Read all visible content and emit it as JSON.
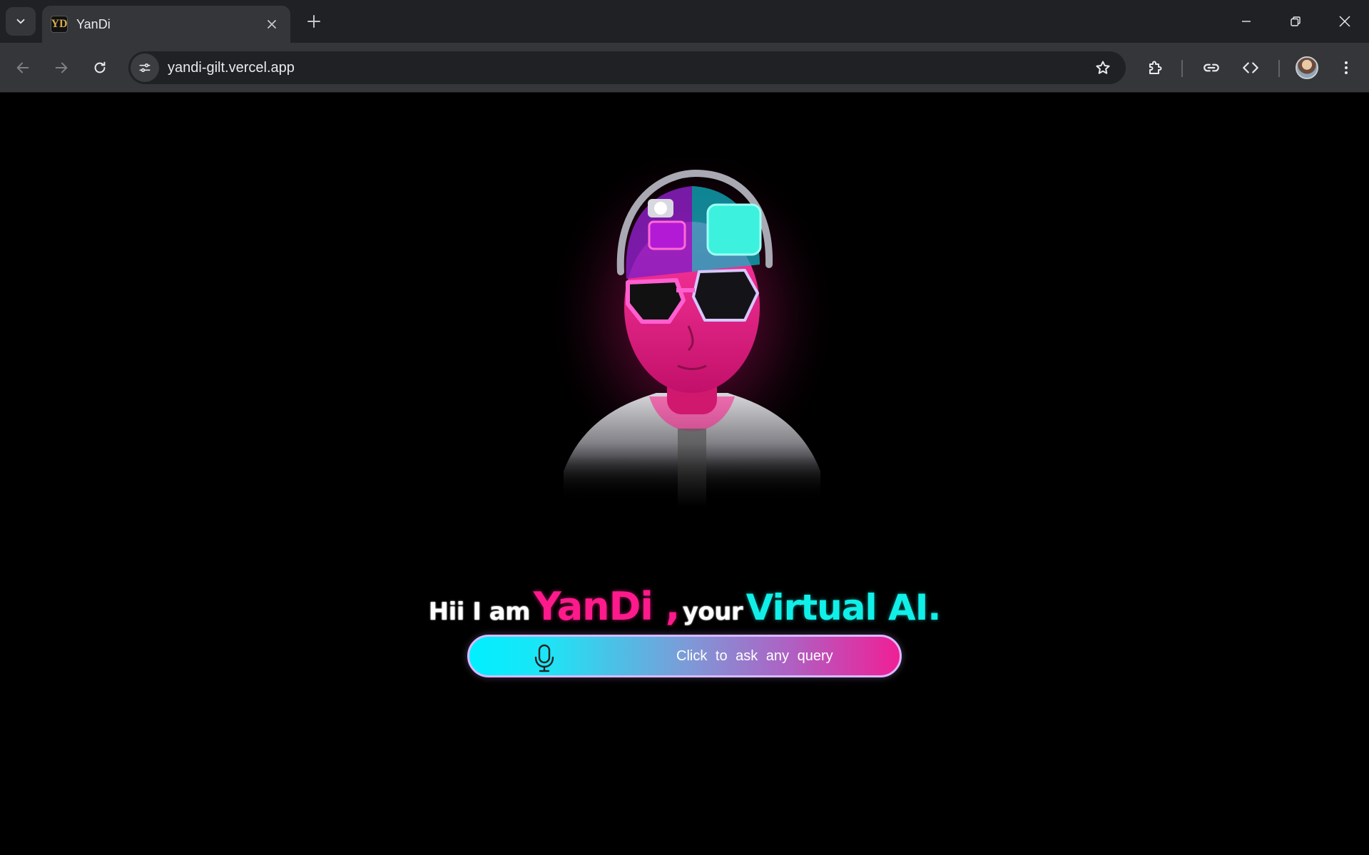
{
  "browser": {
    "tab_title": "YanDi",
    "favicon_letter": "YD",
    "url": "yandi-gilt.vercel.app"
  },
  "icons": {
    "tab_search": "chevron-down-icon",
    "tab_close": "close-icon",
    "new_tab": "plus-icon",
    "back": "arrow-left-icon",
    "forward": "arrow-right-icon",
    "reload": "reload-icon",
    "site_info": "tune-icon",
    "bookmark": "star-icon",
    "extensions": "puzzle-icon",
    "link": "link-icon",
    "devtools": "code-icon",
    "menu": "kebab-icon",
    "mic": "microphone-icon"
  },
  "page": {
    "tagline": {
      "intro": "Hii I am",
      "name": "YanDi ,",
      "middle": "your",
      "role": "Virtual AI."
    },
    "query_button_label": "Click to ask any query"
  },
  "colors": {
    "accent_pink": "#ff1a8c",
    "accent_cyan": "#10f0e8",
    "background": "#000000"
  }
}
